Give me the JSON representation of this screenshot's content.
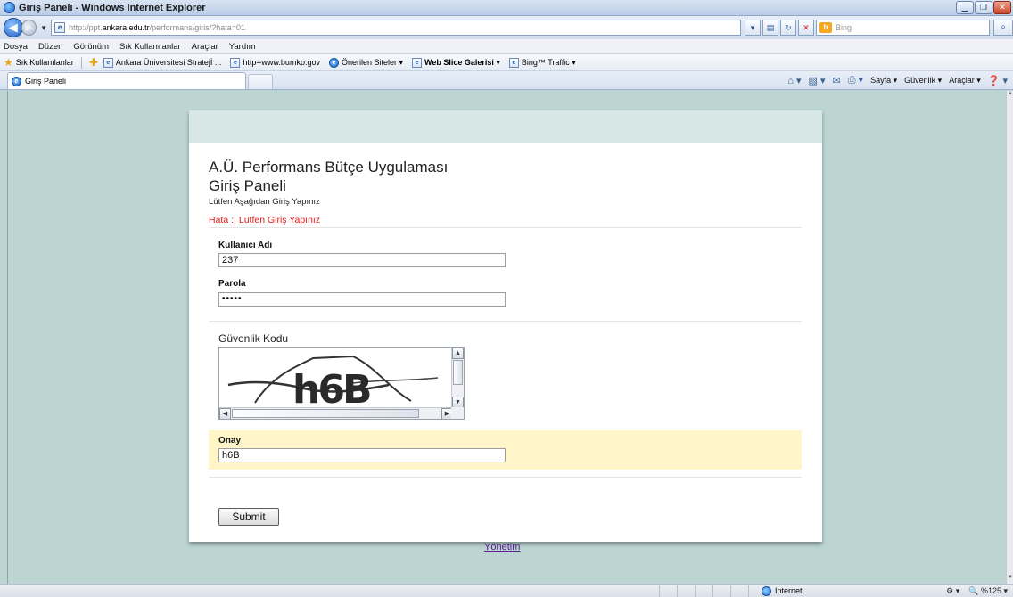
{
  "window": {
    "title": "Giriş Paneli - Windows Internet Explorer"
  },
  "address": {
    "url_prefix": "http://ppt.",
    "url_domain": "ankara.edu.tr",
    "url_path": "/performans/giris/?hata=01",
    "search_placeholder": "Bing"
  },
  "menu": {
    "items": [
      "Dosya",
      "Düzen",
      "Görünüm",
      "Sık Kullanılanlar",
      "Araçlar",
      "Yardım"
    ]
  },
  "favorites": {
    "label": "Sık Kullanılanlar",
    "items": [
      "Ankara Üniversitesi Stratejİ ...",
      "http--www.bumko.gov",
      "Önerilen Siteler ▾",
      "Web Slice Galerisi ▾",
      "Bing™ Traffic ▾"
    ]
  },
  "tab": {
    "label": "Giriş Paneli"
  },
  "commandbar": {
    "page": "Sayfa ▾",
    "safety": "Güvenlik ▾",
    "tools": "Araçlar ▾"
  },
  "page": {
    "app_title": "A.Ü. Performans Bütçe Uygulaması",
    "panel_title": "Giriş Paneli",
    "subtitle": "Lütfen Aşağıdan Giriş Yapınız",
    "error": "Hata :: Lütfen Giriş Yapınız",
    "username_label": "Kullanıcı Adı",
    "username_value": "237",
    "password_label": "Parola",
    "password_value": "•••••",
    "security_label": "Güvenlik Kodu",
    "captcha_text": "h6B",
    "confirm_label": "Onay",
    "confirm_value": "h6B",
    "submit_label": "Submit",
    "footer_link": "Yönetim"
  },
  "status": {
    "zone": "Internet",
    "zoom": "%125 ▾"
  }
}
